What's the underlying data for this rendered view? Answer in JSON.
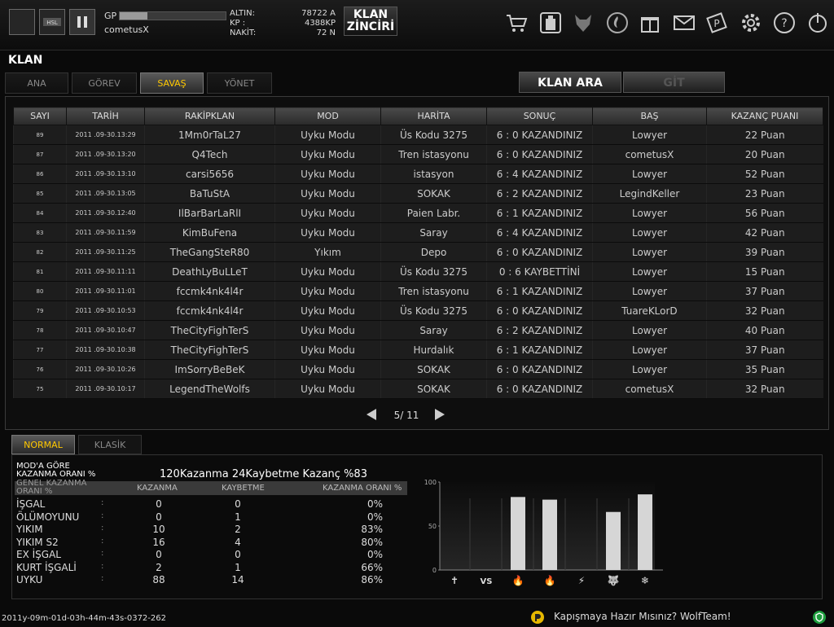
{
  "header": {
    "gp_label": "GP",
    "gp_progress": 0.26,
    "username": "cometusX",
    "currencies": [
      {
        "label": "ALTIN:",
        "value": "78722 A"
      },
      {
        "label": "KP :",
        "value": "4388KP"
      },
      {
        "label": "NAKİT:",
        "value": "72 N"
      }
    ],
    "klan_zinciri_line1": "KLAN",
    "klan_zinciri_line2": "ZİNCİRİ",
    "icons": [
      "cart-icon",
      "character-icon",
      "wolf-icon",
      "fire-icon",
      "gift-icon",
      "mail-icon",
      "coupon-icon",
      "gear-icon",
      "help-icon",
      "power-icon"
    ]
  },
  "page_title": "KLAN",
  "tabs": [
    {
      "label": "ANA",
      "active": false
    },
    {
      "label": "GÖREV",
      "active": false
    },
    {
      "label": "SAVAŞ",
      "active": true
    },
    {
      "label": "YÖNET",
      "active": false
    }
  ],
  "klan_ara_label": "KLAN ARA",
  "git_label": "GİT",
  "table": {
    "headers": [
      "SAYI",
      "TARİH",
      "RAKİPKLAN",
      "MOD",
      "HARİTA",
      "SONUÇ",
      "BAŞ",
      "KAZANÇ PUANI"
    ],
    "rows": [
      [
        "89",
        "2011 .09-30.13:29",
        "1Mm0rTaL27",
        "Uyku Modu",
        "Üs Kodu 3275",
        "6 : 0 KAZANDINIZ",
        "Lowyer",
        "22 Puan"
      ],
      [
        "87",
        "2011 .09-30.13:20",
        "Q4Tech",
        "Uyku Modu",
        "Tren istasyonu",
        "6 : 0 KAZANDINIZ",
        "cometusX",
        "20 Puan"
      ],
      [
        "86",
        "2011 .09-30.13:10",
        "carsi5656",
        "Uyku Modu",
        "istasyon",
        "6 : 4 KAZANDINIZ",
        "Lowyer",
        "52 Puan"
      ],
      [
        "85",
        "2011 .09-30.13:05",
        "BaTuStA",
        "Uyku Modu",
        "SOKAK",
        "6 : 2 KAZANDINIZ",
        "LegindKeller",
        "23 Puan"
      ],
      [
        "84",
        "2011 .09-30.12:40",
        "IlBarBarLaRlI",
        "Uyku Modu",
        "Paien Labr.",
        "6 : 1 KAZANDINIZ",
        "Lowyer",
        "56 Puan"
      ],
      [
        "83",
        "2011 .09-30.11:59",
        "KimBuFena",
        "Uyku Modu",
        "Saray",
        "6 : 4 KAZANDINIZ",
        "Lowyer",
        "42 Puan"
      ],
      [
        "82",
        "2011 .09-30.11:25",
        "TheGangSteR80",
        "Yıkım",
        "Depo",
        "6 : 0 KAZANDINIZ",
        "Lowyer",
        "39 Puan"
      ],
      [
        "81",
        "2011 .09-30.11:11",
        "DeathLyBuLLeT",
        "Uyku Modu",
        "Üs Kodu 3275",
        "0 : 6 KAYBETTİNİ",
        "Lowyer",
        "15 Puan"
      ],
      [
        "80",
        "2011 .09-30.11:01",
        "fccmk4nk4l4r",
        "Uyku Modu",
        "Tren istasyonu",
        "6 : 1 KAZANDINIZ",
        "Lowyer",
        "37 Puan"
      ],
      [
        "79",
        "2011 .09-30.10:53",
        "fccmk4nk4l4r",
        "Uyku Modu",
        "Üs Kodu 3275",
        "6 : 0 KAZANDINIZ",
        "TuareKLorD",
        "32 Puan"
      ],
      [
        "78",
        "2011 .09-30.10:47",
        "TheCityFighTerS",
        "Uyku Modu",
        "Saray",
        "6 : 2 KAZANDINIZ",
        "Lowyer",
        "40 Puan"
      ],
      [
        "77",
        "2011 .09-30.10:38",
        "TheCityFighTerS",
        "Uyku Modu",
        "Hurdalık",
        "6 : 1 KAZANDINIZ",
        "Lowyer",
        "37 Puan"
      ],
      [
        "76",
        "2011 .09-30.10:26",
        "ImSorryBeBeK",
        "Uyku Modu",
        "SOKAK",
        "6 : 0 KAZANDINIZ",
        "Lowyer",
        "35 Puan"
      ],
      [
        "75",
        "2011 .09-30.10:17",
        "LegendTheWolfs",
        "Uyku Modu",
        "SOKAK",
        "6 : 0 KAZANDINIZ",
        "cometusX",
        "32 Puan"
      ]
    ]
  },
  "pager": {
    "text": "5/ 11"
  },
  "bottom_tabs": [
    {
      "label": "NORMAL",
      "active": true
    },
    {
      "label": "KLASİK",
      "active": false
    }
  ],
  "stats": {
    "mode_label_line1": "MOD'A GÖRE",
    "mode_label_line2": "KAZANMA ORANI %",
    "summary": "120Kazanma 24Kaybetme Kazanç %83",
    "general_line1": "GENEL KAZANMA",
    "general_line2": "ORANI %",
    "col_headers": [
      "KAZANMA",
      "KAYBETME",
      "KAZANMA ORANI %"
    ],
    "rows": [
      {
        "mode": "İŞGAL",
        "win": "0",
        "loss": "0",
        "rate": "0%"
      },
      {
        "mode": "ÖLÜMOYUNU",
        "win": "0",
        "loss": "1",
        "rate": "0%"
      },
      {
        "mode": "YIKIM",
        "win": "10",
        "loss": "2",
        "rate": "83%"
      },
      {
        "mode": "YIKIM S2",
        "win": "16",
        "loss": "4",
        "rate": "80%"
      },
      {
        "mode": "EX İŞGAL",
        "win": "0",
        "loss": "0",
        "rate": "0%"
      },
      {
        "mode": "KURT İŞGALİ",
        "win": "2",
        "loss": "1",
        "rate": "66%"
      },
      {
        "mode": "UYKU",
        "win": "88",
        "loss": "14",
        "rate": "86%"
      }
    ]
  },
  "chart_data": {
    "type": "bar",
    "categories": [
      "cross-icon",
      "vs-icon",
      "fire-icon",
      "fire-s2-icon",
      "wolf-run-icon",
      "wolf-ns-icon",
      "snowflake-icon"
    ],
    "values": [
      0,
      0,
      83,
      80,
      0,
      66,
      86
    ],
    "ylim": [
      0,
      100
    ],
    "yticks": [
      "100",
      "50",
      "0"
    ]
  },
  "footer": {
    "left_text": "2011y-09m-01d-03h-44m-43s-0372-262",
    "message": "Kapışmaya Hazır Mısınız? WolfTeam!"
  }
}
